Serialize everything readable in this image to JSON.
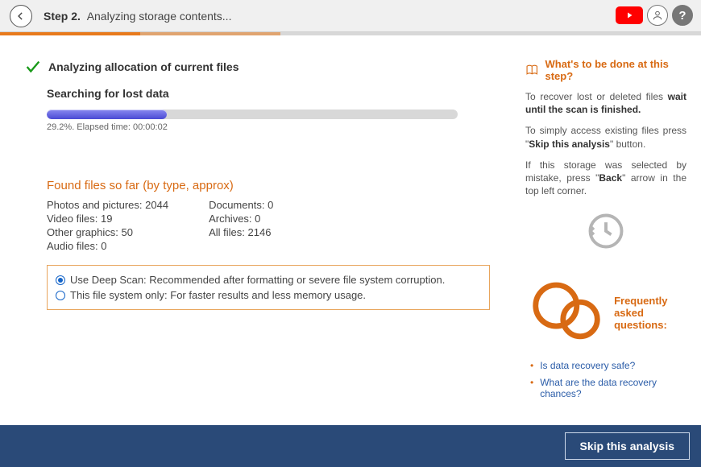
{
  "header": {
    "step_label": "Step 2.",
    "title": "Analyzing storage contents..."
  },
  "main": {
    "check_label": "Analyzing allocation of current files",
    "search_label": "Searching for lost data",
    "progress_percent": 29.2,
    "progress_text": "29.2%. Elapsed time: 00:00:02",
    "found_header": "Found files so far (by type, approx)",
    "stats": {
      "col1": [
        {
          "label": "Photos and pictures:",
          "value": "2044"
        },
        {
          "label": "Video files:",
          "value": "19"
        },
        {
          "label": "Other graphics:",
          "value": "50"
        },
        {
          "label": "Audio files:",
          "value": "0"
        }
      ],
      "col2": [
        {
          "label": "Documents:",
          "value": "0"
        },
        {
          "label": "Archives:",
          "value": "0"
        },
        {
          "label": "All files:",
          "value": "2146"
        }
      ]
    },
    "scan_options": {
      "deep": "Use Deep Scan: Recommended after formatting or severe file system corruption.",
      "fs_only": "This file system only: For faster results and less memory usage.",
      "selected": "deep"
    }
  },
  "side": {
    "title": "What's to be done at this step?",
    "p1a": "To recover lost or deleted files ",
    "p1b": "wait until the scan is finished.",
    "p2a": "To simply access existing files press \"",
    "p2b": "Skip this analysis",
    "p2c": "\" button.",
    "p3a": "If this storage was selected by mistake, press \"",
    "p3b": "Back",
    "p3c": "\" arrow in the top left corner.",
    "faq_title": "Frequently asked questions:",
    "faq": [
      "Is data recovery safe?",
      "What are the data recovery chances?"
    ]
  },
  "footer": {
    "skip_label": "Skip this analysis"
  }
}
